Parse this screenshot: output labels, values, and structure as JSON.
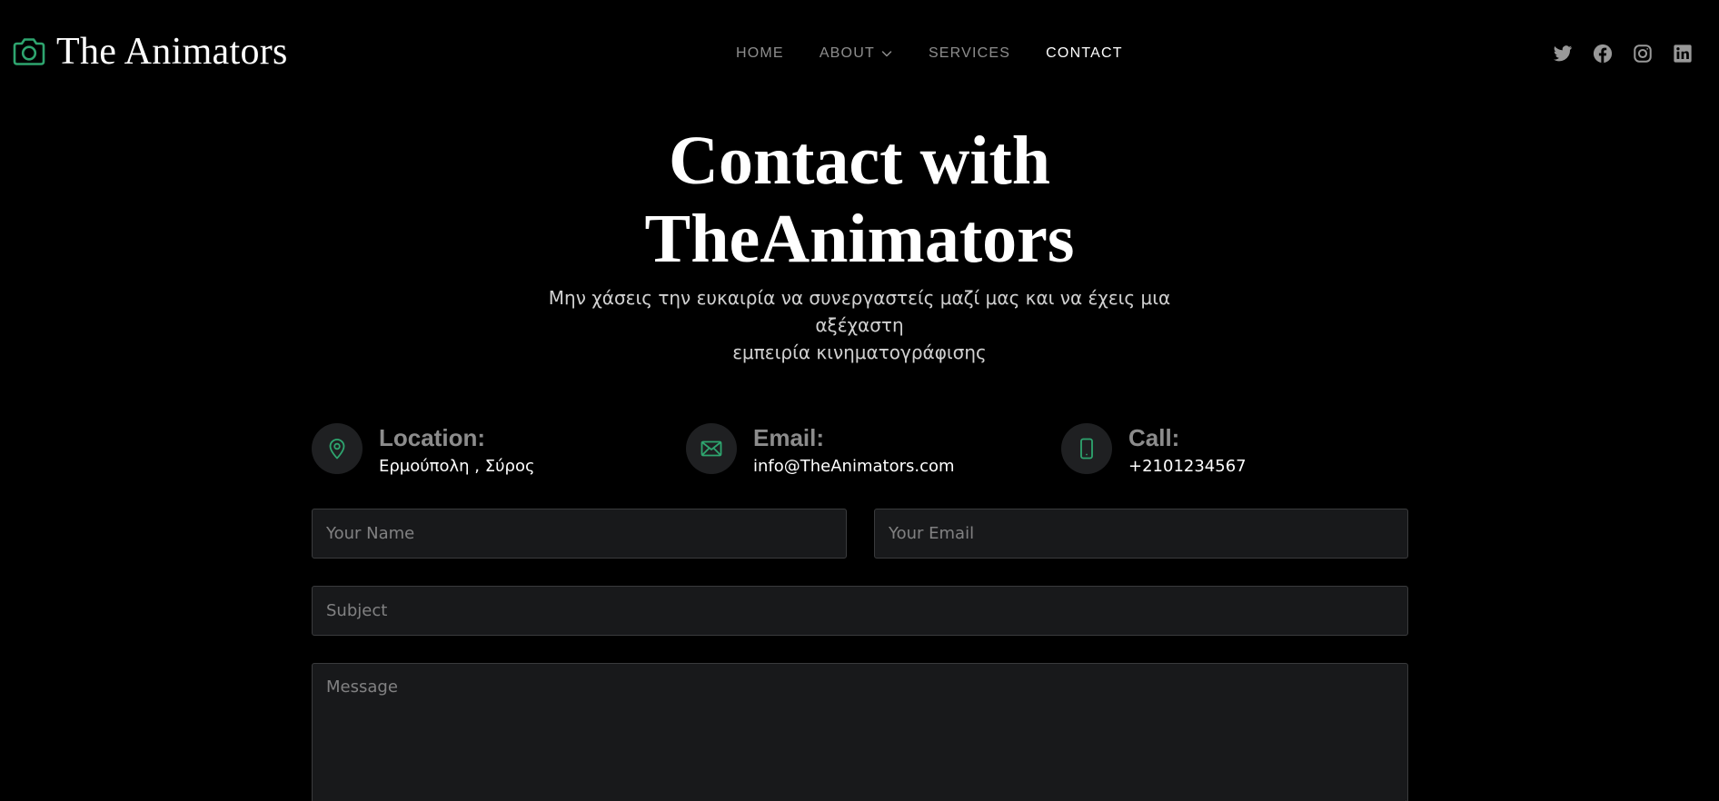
{
  "brand": {
    "name": "The Animators",
    "icon": "camera-icon",
    "accent_color": "#2ea56f"
  },
  "nav": {
    "items": [
      {
        "label": "HOME",
        "active": false
      },
      {
        "label": "ABOUT",
        "active": false,
        "has_dropdown": true
      },
      {
        "label": "SERVICES",
        "active": false
      },
      {
        "label": "CONTACT",
        "active": true
      }
    ]
  },
  "social": [
    {
      "icon": "twitter-icon"
    },
    {
      "icon": "facebook-icon"
    },
    {
      "icon": "instagram-icon"
    },
    {
      "icon": "linkedin-icon"
    }
  ],
  "hero": {
    "title_line1": "Contact with",
    "title_line2": "TheAnimators",
    "subtitle_line1": "Μην χάσεις την ευκαιρία να συνεργαστείς μαζί μας και να έχεις μια αξέχαστη",
    "subtitle_line2": "εμπειρία κινηματογράφισης"
  },
  "contact_info": {
    "location": {
      "label": "Location:",
      "value": "Ερμούπολη , Σύρος",
      "icon": "map-pin-icon"
    },
    "email": {
      "label": "Email:",
      "value": "info@TheAnimators.com",
      "icon": "envelope-icon"
    },
    "call": {
      "label": "Call:",
      "value": "+2101234567",
      "icon": "phone-icon"
    }
  },
  "form": {
    "name_placeholder": "Your Name",
    "email_placeholder": "Your Email",
    "subject_placeholder": "Subject",
    "message_placeholder": "Message"
  },
  "colors": {
    "background": "#000000",
    "field_background": "#18191b",
    "icon_circle": "#1f2022",
    "accent": "#2ea56f"
  }
}
